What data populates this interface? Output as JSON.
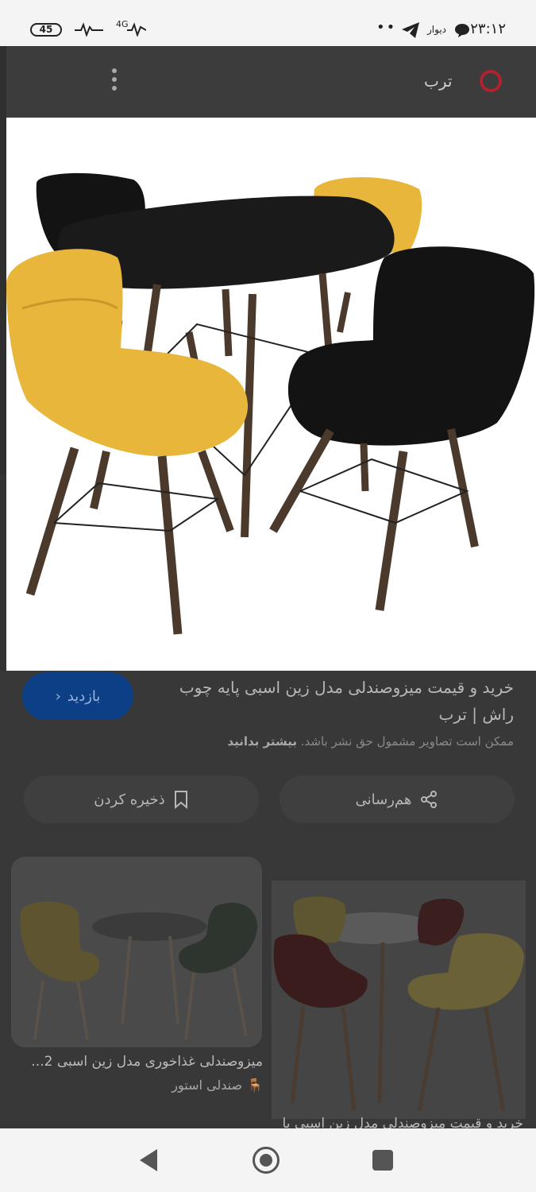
{
  "status_bar": {
    "battery": "45",
    "network": "4G",
    "app_name": "دیوار",
    "time": "۲۳:۱۲",
    "dots": "••"
  },
  "header": {
    "brand": "ترب"
  },
  "product": {
    "title": "خرید و قیمت میزوصندلی مدل زین اسبی پایه چوب راش | ترب",
    "copyright_note": "ممکن است تصاویر مشمول حق نشر باشد.",
    "learn_more": "بیشتر بدانید",
    "visit_label": "بازدید"
  },
  "actions": {
    "share_label": "هم‌رسانی",
    "save_label": "ذخیره کردن"
  },
  "related": [
    {
      "title": "میزوصندلی غذاخوری مدل زین اسبی 2...",
      "source": "صندلی استور"
    },
    {
      "title": "خرید و قیمت میزوصندلی مدل زین اسبی پا"
    }
  ],
  "colors": {
    "chair_yellow": "#e7b63a",
    "chair_black": "#131313",
    "table_top": "#1a1a1a",
    "wood_leg": "#4b3a2c",
    "visit_button": "#0d3f86",
    "brand_ring": "#b0222e"
  }
}
